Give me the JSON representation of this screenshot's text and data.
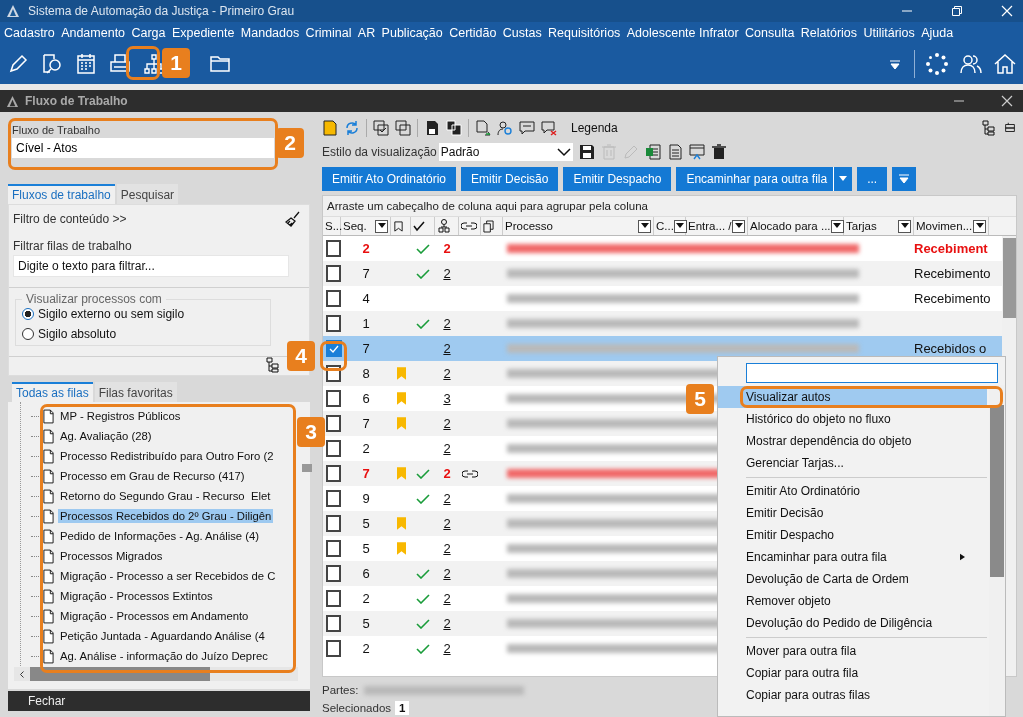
{
  "window": {
    "title": "Sistema de Automação da Justiça - Primeiro Grau"
  },
  "menu": [
    "Cadastro",
    "Andamento",
    "Carga",
    "Expediente",
    "Mandados",
    "Criminal",
    "AR",
    "Publicação",
    "Certidão",
    "Custas",
    "Requisitórios",
    "Adolescente Infrator",
    "Consulta",
    "Relatórios",
    "Utilitários",
    "Ajuda"
  ],
  "child_window": {
    "title": "Fluxo de Trabalho"
  },
  "workflow": {
    "label": "Fluxo de Trabalho",
    "value": "Cível - Atos"
  },
  "left_tabs": [
    {
      "label": "Fluxos de trabalho",
      "selected": true
    },
    {
      "label": "Pesquisar",
      "selected": false
    }
  ],
  "content_filter": {
    "label": "Filtro de conteúdo >>"
  },
  "queue_filter": {
    "label": "Filtrar filas de trabalho",
    "placeholder": "Digite o texto para filtrar..."
  },
  "secrecy": {
    "legend": "Visualizar processos com",
    "options": [
      {
        "label": "Sigilo externo ou sem sigilo",
        "selected": true
      },
      {
        "label": "Sigilo absoluto",
        "selected": false
      }
    ]
  },
  "queue_tabs": [
    {
      "label": "Todas as filas",
      "selected": true
    },
    {
      "label": "Filas favoritas",
      "selected": false
    }
  ],
  "queues": [
    {
      "label": "MP - Registros Públicos",
      "selected": false
    },
    {
      "label": "Ag. Avaliação (28)",
      "selected": false
    },
    {
      "label": "Processo Redistribuído para Outro Foro (2",
      "selected": false
    },
    {
      "label": "Processo em Grau de Recurso (417)",
      "selected": false
    },
    {
      "label": "Retorno do Segundo Grau - Recurso  Elet",
      "selected": false
    },
    {
      "label": "Processos Recebidos do 2º Grau - Diligên",
      "selected": true
    },
    {
      "label": "Pedido de Informações - Ag. Análise (4)",
      "selected": false
    },
    {
      "label": "Processos Migrados",
      "selected": false
    },
    {
      "label": "Migração - Processo a ser Recebidos de C",
      "selected": false
    },
    {
      "label": "Migração - Processos Extintos",
      "selected": false
    },
    {
      "label": "Migração - Processos em Andamento",
      "selected": false
    },
    {
      "label": "Petição Juntada - Aguardando Análise (4",
      "selected": false
    },
    {
      "label": "Ag. Análise - informação do Juízo Deprec",
      "selected": false
    }
  ],
  "close_button": "Fechar",
  "legend_label": "Legenda",
  "view_style": {
    "label": "Estilo da visualização",
    "value": "Padrão"
  },
  "actions": [
    {
      "label": "Emitir Ato Ordinatório",
      "split": false
    },
    {
      "label": "Emitir Decisão",
      "split": false
    },
    {
      "label": "Emitir Despacho",
      "split": false
    },
    {
      "label": "Encaminhar para outra fila",
      "split": true
    },
    {
      "label": "...",
      "split": false
    }
  ],
  "group_hint": "Arraste um cabeçalho de coluna aqui para agrupar pela coluna",
  "columns": [
    {
      "kind": "text",
      "label": "S..."
    },
    {
      "kind": "text",
      "label": "Seq.",
      "filter": true
    },
    {
      "kind": "bookmark"
    },
    {
      "kind": "check"
    },
    {
      "kind": "tree"
    },
    {
      "kind": "link"
    },
    {
      "kind": "copy"
    },
    {
      "kind": "text",
      "label": "Processo",
      "filter": true
    },
    {
      "kind": "text",
      "label": "C...",
      "filter": true
    },
    {
      "kind": "text",
      "label": "Entra... /",
      "filter": true
    },
    {
      "kind": "text",
      "label": "Alocado para ...",
      "filter": true
    },
    {
      "kind": "text",
      "label": "Tarjas",
      "filter": true
    },
    {
      "kind": "text",
      "label": "Movimen...",
      "filter": true
    }
  ],
  "rows": [
    {
      "seq": "2",
      "urgent": true,
      "selected": false,
      "bookmark": false,
      "done": true,
      "count": "2",
      "linked": false,
      "movement": "Recebiment"
    },
    {
      "seq": "7",
      "urgent": false,
      "selected": false,
      "bookmark": false,
      "done": true,
      "count": "2",
      "linked": false,
      "movement": "Recebimento"
    },
    {
      "seq": "4",
      "urgent": false,
      "selected": false,
      "bookmark": false,
      "done": false,
      "linked": false,
      "movement": "Recebimento"
    },
    {
      "seq": "1",
      "urgent": false,
      "selected": false,
      "bookmark": false,
      "done": true,
      "count": "2",
      "linked": false
    },
    {
      "seq": "7",
      "urgent": false,
      "selected": true,
      "bookmark": false,
      "done": false,
      "count": "2",
      "linked": false,
      "movement": "Recebidos o"
    },
    {
      "seq": "8",
      "urgent": false,
      "selected": false,
      "bookmark": true,
      "done": false,
      "count": "2",
      "linked": false
    },
    {
      "seq": "6",
      "urgent": false,
      "selected": false,
      "bookmark": true,
      "done": false,
      "count": "3",
      "linked": false
    },
    {
      "seq": "7",
      "urgent": false,
      "selected": false,
      "bookmark": true,
      "done": false,
      "count": "2",
      "linked": false
    },
    {
      "seq": "2",
      "urgent": false,
      "selected": false,
      "bookmark": false,
      "done": false,
      "count": "2",
      "linked": false
    },
    {
      "seq": "7",
      "urgent": true,
      "selected": false,
      "bookmark": true,
      "done": true,
      "count": "2",
      "linked": true
    },
    {
      "seq": "9",
      "urgent": false,
      "selected": false,
      "bookmark": false,
      "done": true,
      "count": "2",
      "linked": false
    },
    {
      "seq": "5",
      "urgent": false,
      "selected": false,
      "bookmark": true,
      "done": false,
      "count": "2",
      "linked": false
    },
    {
      "seq": "5",
      "urgent": false,
      "selected": false,
      "bookmark": true,
      "done": false,
      "count": "2",
      "linked": false
    },
    {
      "seq": "6",
      "urgent": false,
      "selected": false,
      "bookmark": false,
      "done": true,
      "count": "2",
      "linked": false
    },
    {
      "seq": "2",
      "urgent": false,
      "selected": false,
      "bookmark": false,
      "done": true,
      "count": "2",
      "linked": false
    },
    {
      "seq": "5",
      "urgent": false,
      "selected": false,
      "bookmark": false,
      "done": true,
      "count": "2",
      "linked": false
    },
    {
      "seq": "2",
      "urgent": false,
      "selected": false,
      "bookmark": false,
      "done": true,
      "count": "2",
      "linked": false
    }
  ],
  "parts_label": "Partes:",
  "selected_count": {
    "label": "Selecionados",
    "value": "1"
  },
  "context_menu": {
    "groups": [
      [
        {
          "kind": "item",
          "label": "Visualizar autos",
          "selected": true
        },
        {
          "kind": "item",
          "label": "Histórico do objeto no fluxo",
          "selected": false
        },
        {
          "kind": "item",
          "label": "Mostrar dependência do objeto",
          "selected": false
        },
        {
          "kind": "item",
          "label": "Gerenciar Tarjas...",
          "selected": false
        }
      ],
      [
        {
          "kind": "item",
          "label": "Emitir Ato Ordinatório",
          "selected": false
        },
        {
          "kind": "item",
          "label": "Emitir Decisão",
          "selected": false
        },
        {
          "kind": "item",
          "label": "Emitir Despacho",
          "selected": false
        },
        {
          "kind": "submenu",
          "label": "Encaminhar para outra fila",
          "selected": false
        },
        {
          "kind": "item",
          "label": "Devolução de Carta de Ordem",
          "selected": false
        },
        {
          "kind": "item",
          "label": "Remover objeto",
          "selected": false
        },
        {
          "kind": "item",
          "label": "Devolução do Pedido de Diligência",
          "selected": false
        }
      ],
      [
        {
          "kind": "item",
          "label": "Mover para outra fila",
          "selected": false
        },
        {
          "kind": "item",
          "label": "Copiar para outra fila",
          "selected": false
        },
        {
          "kind": "item",
          "label": "Copiar para outras filas",
          "selected": false
        }
      ]
    ]
  },
  "callouts": [
    {
      "label": "1"
    },
    {
      "label": "2"
    },
    {
      "label": "3"
    },
    {
      "label": "4"
    },
    {
      "label": "5"
    }
  ]
}
